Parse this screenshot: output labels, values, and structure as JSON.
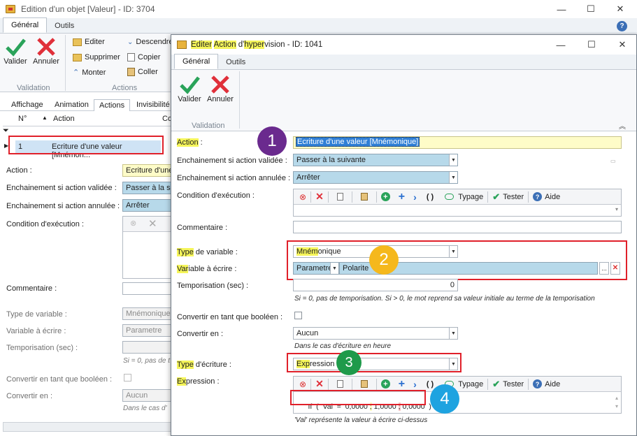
{
  "bg_window": {
    "title": "Edition d'un objet [Valeur] - ID: 3704",
    "tabs": [
      "Général",
      "Outils"
    ],
    "ribbon": {
      "valider": "Valider",
      "annuler": "Annuler",
      "editer": "Editer",
      "supprimer": "Supprimer",
      "monter": "Monter",
      "descendre": "Descendre",
      "copier": "Copier",
      "coller": "Coller",
      "group_validation": "Validation",
      "group_actions": "Actions"
    },
    "subtabs": [
      "Affichage",
      "Animation",
      "Actions",
      "Invisibilité"
    ],
    "grid": {
      "col_num": "N°",
      "col_action": "Action",
      "col_c": "Co",
      "row_num": "1",
      "row_action": "Ecriture d'une valeur [Mnémon..."
    },
    "labels": {
      "action": "Action :",
      "ench_valid": "Enchainement si action validée :",
      "ench_annul": "Enchainement si action annulée :",
      "condition": "Condition d'exécution :",
      "commentaire": "Commentaire :",
      "type_var": "Type de variable :",
      "var_ecrire": "Variable à écrire :",
      "tempo": "Temporisation (sec) :",
      "convertir_bool": "Convertir en tant que booléen :",
      "convertir_en": "Convertir en :"
    },
    "values": {
      "action": "Ecriture d'une v",
      "ench_valid": "Passer à la su",
      "ench_annul": "Arrêter",
      "type_var": "Mnémonique",
      "var_param": "Parametre",
      "tempo_note": "Si = 0, pas de t",
      "convertir_en": "Aucun",
      "convertir_note": "Dans le cas d'"
    }
  },
  "dialog": {
    "title_parts": [
      {
        "t": "Editer",
        "hl": true
      },
      {
        "t": " ",
        "hl": false
      },
      {
        "t": "Action",
        "hl": true
      },
      {
        "t": " d'",
        "hl": false
      },
      {
        "t": "hyper",
        "hl": true
      },
      {
        "t": "vision - ID: 1041",
        "hl": false
      }
    ],
    "tabs": [
      "Général",
      "Outils"
    ],
    "ribbon": {
      "valider": "Valider",
      "annuler": "Annuler",
      "group_validation": "Validation"
    },
    "labels": {
      "action_hl": "Action",
      "action_rest": " :",
      "ench_valid": "Enchainement si action validée :",
      "ench_annul": "Enchainement si action annulée :",
      "condition": "Condition d'exécution :",
      "commentaire": "Commentaire :",
      "type_var_hl": "Type",
      "type_var_rest": " de variable :",
      "var_hl": "Var",
      "var_rest": "iable à écrire :",
      "tempo": "Temporisation (sec) :",
      "convertir_bool": "Convertir en tant que booléen :",
      "convertir_en": "Convertir en :",
      "type_ecr_hl": "Type",
      "type_ecr_rest": " d'écriture :",
      "expr_hl": "Ex",
      "expr_rest": "pression :"
    },
    "values": {
      "action": "Ecriture d'une valeur [Mnémonique]",
      "ench_valid": "Passer à la suivante",
      "ench_annul": "Arrêter",
      "type_var_hl": "Mném",
      "type_var_rest": "onique",
      "var_param": "Parametre",
      "var_name": "Polarite",
      "tempo": "0",
      "tempo_note": "Si = 0, pas de temporisation. Si > 0, le mot reprend sa valeur initiale au terme de la temporisation",
      "convertir_en": "Aucun",
      "convertir_note": "Dans le cas d'écriture en heure",
      "type_ecr_hl": "Exp",
      "type_ecr_rest": "ression",
      "expression_parts": [
        "If  (  Val  =  0,0000 ",
        ";",
        " 1,0000 ",
        ";",
        " 0,0000  )"
      ],
      "expr_note": "'Val' représente la valeur à écrire ci-dessus"
    },
    "toolbar": {
      "paren": "( )",
      "typage": "Typage",
      "tester": "Tester",
      "aide": "Aide"
    }
  },
  "badges": [
    "1",
    "2",
    "3",
    "4"
  ],
  "colors": {
    "badge1": "#6a2a8e",
    "badge2": "#f5b81c",
    "badge3": "#1e9a4a",
    "badge4": "#1ea3e0",
    "red": "#e0202a",
    "highlight": "#f5f55a"
  }
}
